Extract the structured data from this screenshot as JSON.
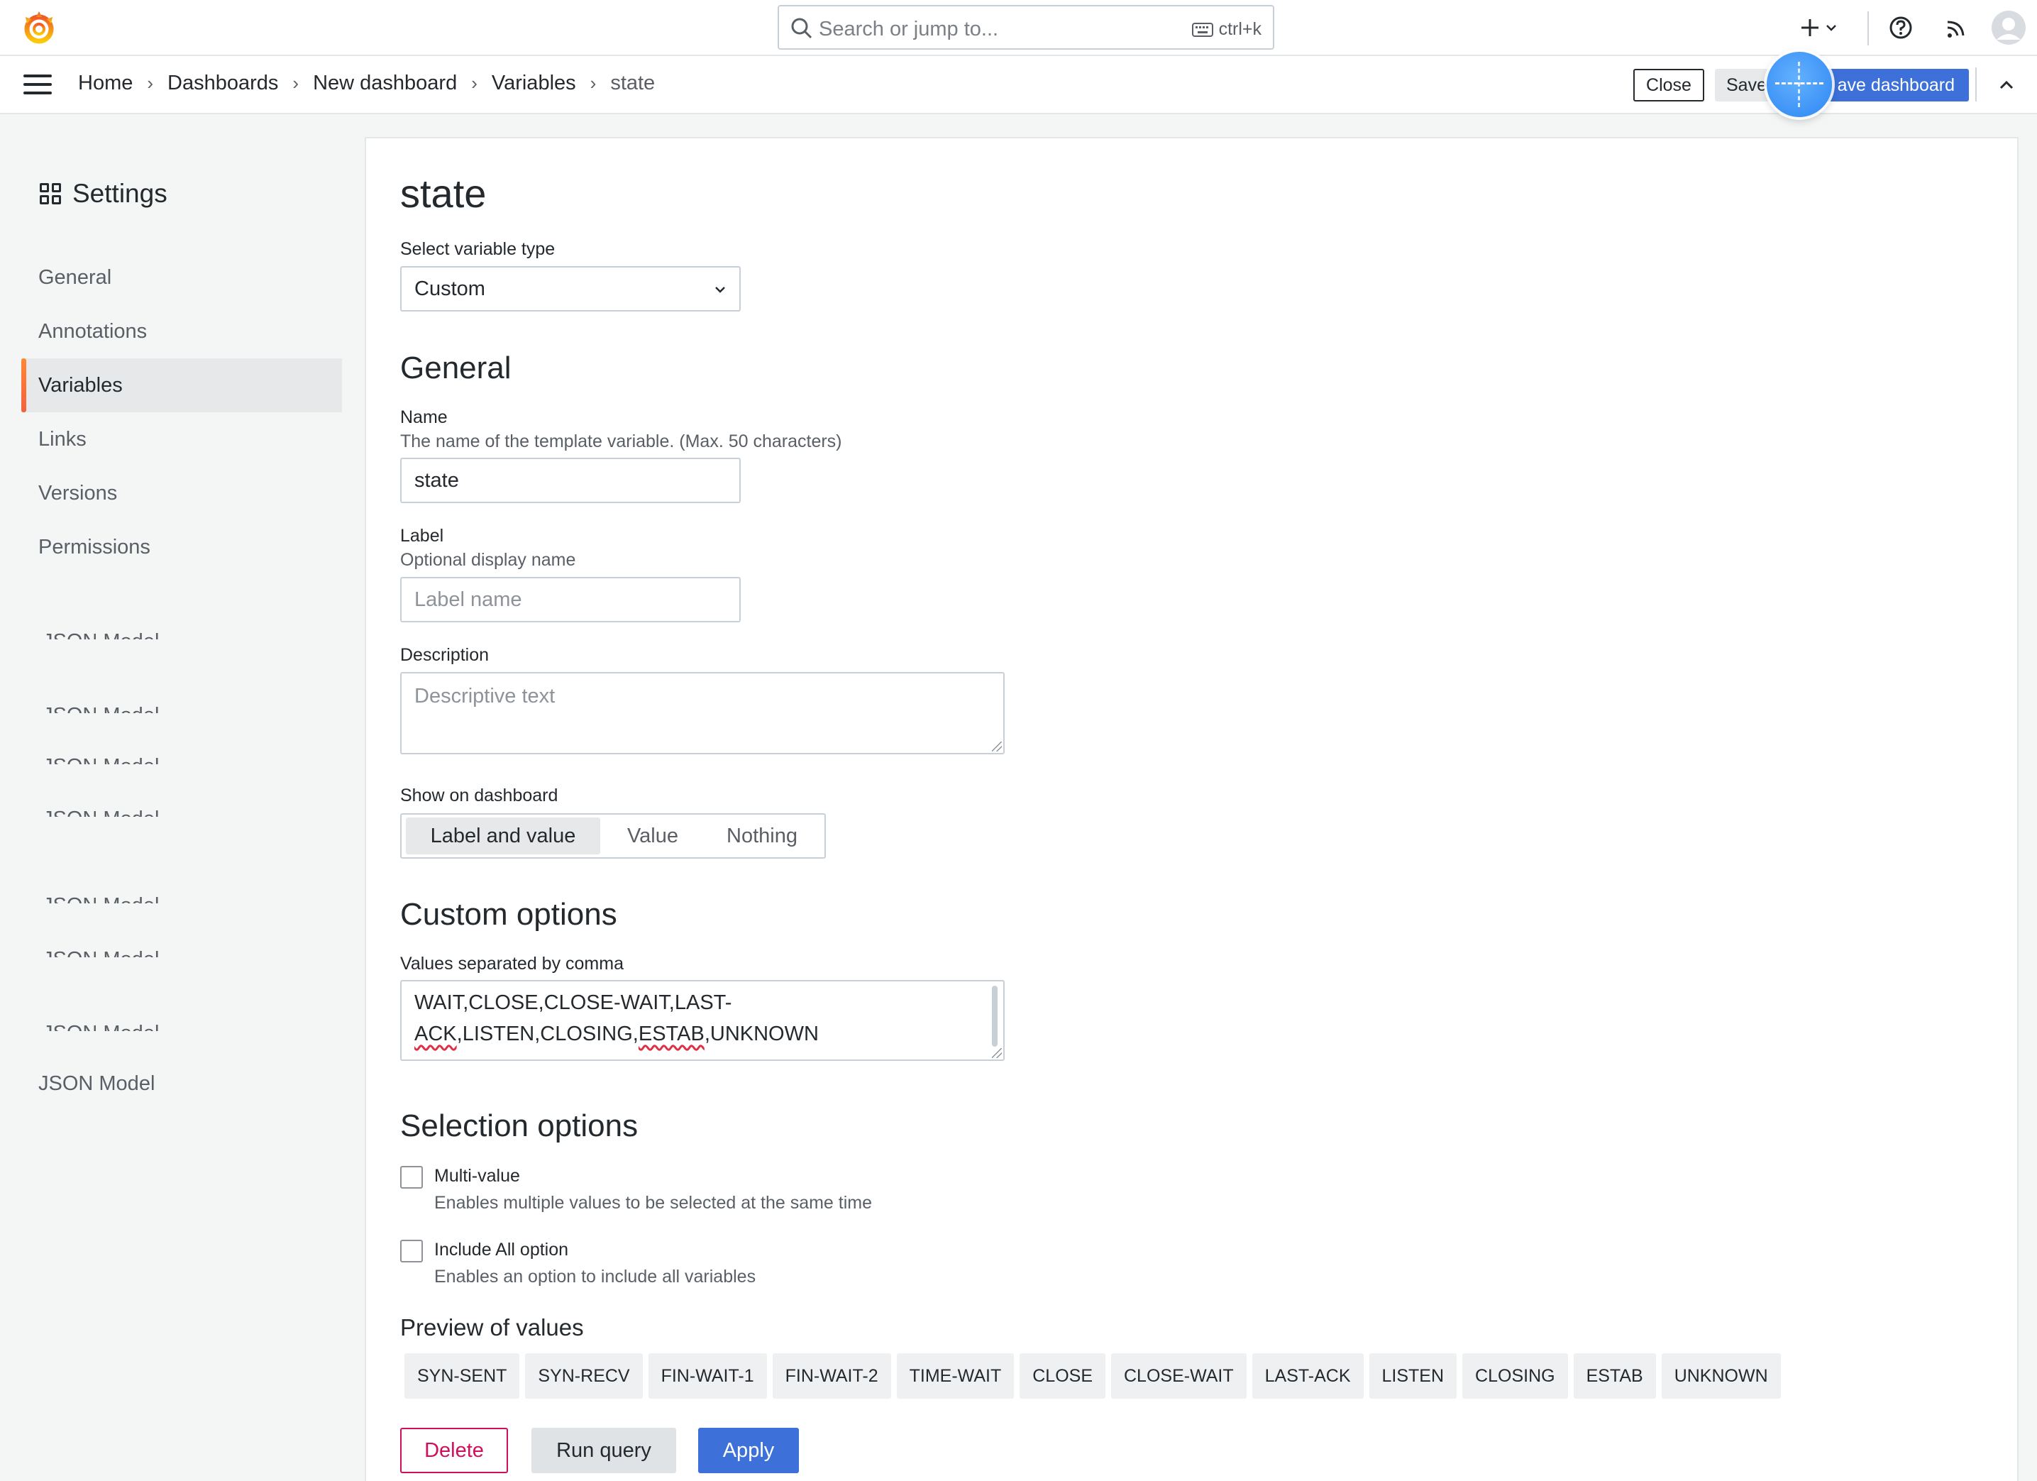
{
  "topbar": {
    "search_placeholder": "Search or jump to...",
    "search_shortcut": "ctrl+k",
    "icons": [
      "grafana-logo-icon",
      "search-icon",
      "keyboard-icon",
      "plus-icon",
      "chevron-down-icon",
      "help-icon",
      "rss-icon",
      "avatar"
    ]
  },
  "breadcrumb": [
    "Home",
    "Dashboards",
    "New dashboard",
    "Variables",
    "state"
  ],
  "actions": {
    "close": "Close",
    "save_as": "Save",
    "save_dashboard": "ave dashboard"
  },
  "sidebar": {
    "title": "Settings",
    "items": [
      "General",
      "Annotations",
      "Variables",
      "Links",
      "Versions",
      "Permissions"
    ],
    "active": "Variables",
    "ghost_label": "JSON Model",
    "last_item": "JSON Model"
  },
  "editor": {
    "title": "state",
    "type_label": "Select variable type",
    "type_value": "Custom",
    "general_heading": "General",
    "name_label": "Name",
    "name_desc": "The name of the template variable. (Max. 50 characters)",
    "name_value": "state",
    "label_label": "Label",
    "label_desc": "Optional display name",
    "label_placeholder": "Label name",
    "desc_label": "Description",
    "desc_placeholder": "Descriptive text",
    "show_label": "Show on dashboard",
    "show_options": [
      "Label and value",
      "Value",
      "Nothing"
    ],
    "show_selected": "Label and value",
    "custom_heading": "Custom options",
    "values_label": "Values separated by comma",
    "values_line1": "WAIT,CLOSE,CLOSE-WAIT,LAST-",
    "values_line2a": "ACK",
    "values_line2b": ",LISTEN,CLOSING,",
    "values_line2c": "ESTAB",
    "values_line2d": ",UNKNOWN",
    "selection_heading": "Selection options",
    "multi_label": "Multi-value",
    "multi_desc": "Enables multiple values to be selected at the same time",
    "multi_checked": false,
    "all_label": "Include All option",
    "all_desc": "Enables an option to include all variables",
    "all_checked": false,
    "preview_heading": "Preview of values",
    "preview_values": [
      "SYN-SENT",
      "SYN-RECV",
      "FIN-WAIT-1",
      "FIN-WAIT-2",
      "TIME-WAIT",
      "CLOSE",
      "CLOSE-WAIT",
      "LAST-ACK",
      "LISTEN",
      "CLOSING",
      "ESTAB",
      "UNKNOWN"
    ],
    "delete": "Delete",
    "run_query": "Run query",
    "apply": "Apply"
  },
  "colors": {
    "accent": "#3d71d9",
    "active_bar": "#f55f3e",
    "danger": "#d10e5c"
  }
}
